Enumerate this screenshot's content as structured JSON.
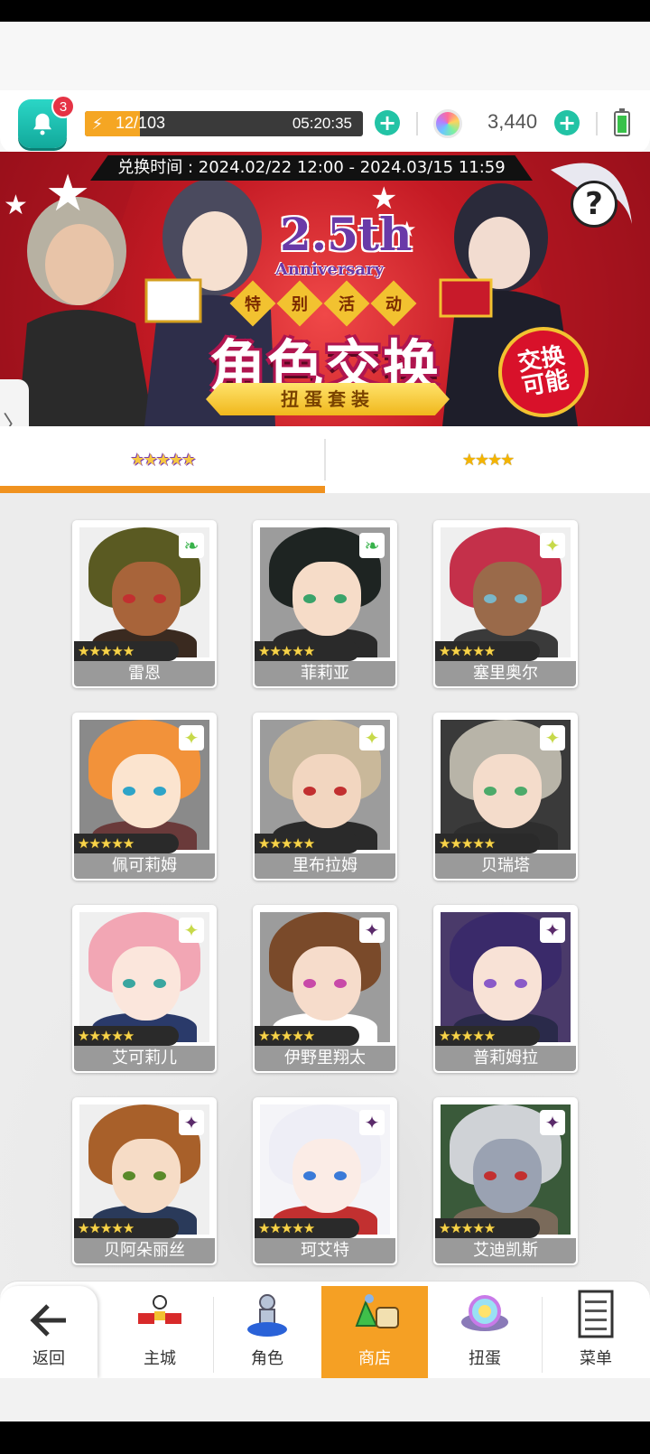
{
  "header": {
    "notification_count": "3",
    "stamina_text": "12/103",
    "stamina_fraction": 0.117,
    "stamina_timer": "05:20:35",
    "gems": "3,440"
  },
  "banner": {
    "exchange_period": "兑换时间 : 2024.02/22 12:00 - 2024.03/15 11:59",
    "anniversary_number": "2.5th",
    "anniversary_word": "Anniversary",
    "event_chars": [
      "特",
      "别",
      "活",
      "动"
    ],
    "title": "角色交换",
    "subtitle": "扭蛋套装",
    "exchange_badge": "交换\n可能",
    "help": "?"
  },
  "tabs": [
    {
      "stars": "★★★★★",
      "rarity": 5,
      "active": true
    },
    {
      "stars": "★★★★",
      "rarity": 4,
      "active": false
    }
  ],
  "characters": [
    {
      "name": "雷恩",
      "stars": "★★★★★",
      "element": "wind-icon",
      "hair": "#5a5a22",
      "skin": "#a8643a",
      "body": "#3a2a20",
      "eye": "#c23030",
      "bg": "#efefef",
      "el_color": "#37b24a",
      "el_glyph": "❧"
    },
    {
      "name": "菲莉亚",
      "stars": "★★★★★",
      "element": "wind-icon",
      "hair": "#1e2422",
      "skin": "#f6dcc8",
      "body": "#2a2a2a",
      "eye": "#3aa36a",
      "bg": "#9c9c9c",
      "el_color": "#37b24a",
      "el_glyph": "❧"
    },
    {
      "name": "塞里奥尔",
      "stars": "★★★★★",
      "element": "light-icon",
      "hair": "#c4304a",
      "skin": "#9a6a4a",
      "body": "#3a3a3a",
      "eye": "#7ab6c8",
      "bg": "#efefef",
      "el_color": "#c7d94a",
      "el_glyph": "✦"
    },
    {
      "name": "佩可莉姆",
      "stars": "★★★★★",
      "element": "light-icon",
      "hair": "#f2923a",
      "skin": "#fbe4cf",
      "body": "#6a3a3a",
      "eye": "#2ea4c8",
      "bg": "#8a8a8a",
      "el_color": "#c7d94a",
      "el_glyph": "✦"
    },
    {
      "name": "里布拉姆",
      "stars": "★★★★★",
      "element": "light-icon",
      "hair": "#c9b89a",
      "skin": "#f2d6c0",
      "body": "#2a2a2a",
      "eye": "#c23030",
      "bg": "#9c9c9c",
      "el_color": "#c7d94a",
      "el_glyph": "✦"
    },
    {
      "name": "贝瑞塔",
      "stars": "★★★★★",
      "element": "light-icon",
      "hair": "#b8b4a8",
      "skin": "#f4dccb",
      "body": "#2e2e2e",
      "eye": "#4caa6a",
      "bg": "#3a3a3a",
      "el_color": "#c7d94a",
      "el_glyph": "✦"
    },
    {
      "name": "艾可莉儿",
      "stars": "★★★★★",
      "element": "light-icon",
      "hair": "#f2a6b4",
      "skin": "#fbe6dc",
      "body": "#2a3a6a",
      "eye": "#3aa6a0",
      "bg": "#efefef",
      "el_color": "#c7d94a",
      "el_glyph": "✦"
    },
    {
      "name": "伊野里翔太",
      "stars": "★★★★★",
      "element": "dark-icon",
      "hair": "#7a4a2a",
      "skin": "#f6dccb",
      "body": "#ffffff",
      "eye": "#c84aa8",
      "bg": "#9c9c9c",
      "el_color": "#5a2a6a",
      "el_glyph": "✦"
    },
    {
      "name": "普莉姆拉",
      "stars": "★★★★★",
      "element": "dark-icon",
      "hair": "#3a2a6a",
      "skin": "#f8e2d6",
      "body": "#2a2a4a",
      "eye": "#8a5ac8",
      "bg": "#4a3a6a",
      "el_color": "#5a2a6a",
      "el_glyph": "✦"
    },
    {
      "name": "贝阿朵丽丝",
      "stars": "★★★★★",
      "element": "dark-icon",
      "hair": "#a8602a",
      "skin": "#f6dcc6",
      "body": "#2a3a5a",
      "eye": "#5a8a2a",
      "bg": "#efefef",
      "el_color": "#5a2a6a",
      "el_glyph": "✦"
    },
    {
      "name": "珂艾特",
      "stars": "★★★★★",
      "element": "dark-icon",
      "hair": "#eeeef6",
      "skin": "#fbece6",
      "body": "#c23030",
      "eye": "#3a7ad8",
      "bg": "#f4f4f8",
      "el_color": "#5a2a6a",
      "el_glyph": "✦"
    },
    {
      "name": "艾迪凯斯",
      "stars": "★★★★★",
      "element": "dark-icon",
      "hair": "#cfd2d6",
      "skin": "#9aa2b2",
      "body": "#7a6a5a",
      "eye": "#c23030",
      "bg": "#3a5a3a",
      "el_color": "#5a2a6a",
      "el_glyph": "✦"
    }
  ],
  "bottom_nav": {
    "back": "返回",
    "items": [
      {
        "label": "主城",
        "icon": "castle-icon"
      },
      {
        "label": "角色",
        "icon": "character-icon"
      },
      {
        "label": "商店",
        "icon": "shop-icon",
        "active": true
      },
      {
        "label": "扭蛋",
        "icon": "gacha-icon"
      },
      {
        "label": "菜单",
        "icon": "menu-icon"
      }
    ]
  },
  "colors": {
    "accent": "#f0921f",
    "teal": "#22c3a5",
    "banner_red": "#c41a24"
  }
}
